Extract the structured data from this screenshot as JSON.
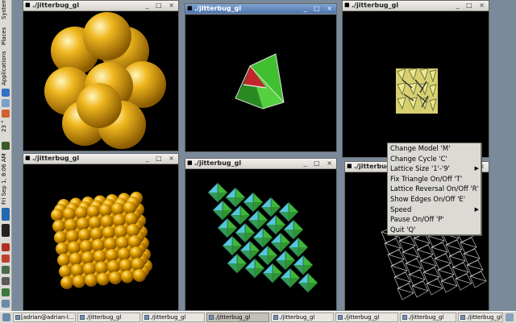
{
  "panel": {
    "menus": [
      "Applications",
      "Places",
      "System"
    ],
    "weather": "23 °",
    "clock": "Fri Sep 1, 8:06 AM",
    "colors": {
      "bg": "#dcdad5",
      "text": "#000000"
    }
  },
  "windows": [
    {
      "title": "./jitterbug_gl",
      "model": "spheres-large",
      "active": false
    },
    {
      "title": "./jitterbug_gl",
      "model": "octahedron",
      "active": true
    },
    {
      "title": "./jitterbug_gl",
      "model": "small-lattice",
      "active": false
    },
    {
      "title": "./jitterbug_gl",
      "model": "spheres-lattice",
      "active": false
    },
    {
      "title": "./jitterbug_gl",
      "model": "octahedra-lattice",
      "active": false
    },
    {
      "title": "./jitterbug_g",
      "model": "wireframe-lattice",
      "active": false
    }
  ],
  "window_buttons": "_ □ ×",
  "context_menu": {
    "items": [
      {
        "label": "Change Model  'M'",
        "submenu": false
      },
      {
        "label": "Change Cycle  'C'",
        "submenu": false
      },
      {
        "label": "Lattice Size  '1'-'9'",
        "submenu": true
      },
      {
        "label": "Fix Triangle On/Off  'T'",
        "submenu": false
      },
      {
        "label": "Lattice Reversal On/Off  'R'",
        "submenu": false
      },
      {
        "label": "Show Edges On/Off  'E'",
        "submenu": false
      },
      {
        "label": "Speed",
        "submenu": true
      },
      {
        "label": "Pause On/Off  'P'",
        "submenu": false
      },
      {
        "label": "Quit  'Q'",
        "submenu": false
      }
    ]
  },
  "taskbar": {
    "items": [
      {
        "label": "[adrian@adrian-l...",
        "pressed": false
      },
      {
        "label": "./jitterbug_gl",
        "pressed": false
      },
      {
        "label": "./jitterbug_gl",
        "pressed": false
      },
      {
        "label": "./jitterbug_gl",
        "pressed": true
      },
      {
        "label": "./jitterbug_gl",
        "pressed": false
      },
      {
        "label": "./jitterbug_gl",
        "pressed": false
      },
      {
        "label": "./jitterbug_gl",
        "pressed": false
      },
      {
        "label": "./jitterbug_gl",
        "pressed": false
      }
    ]
  },
  "colors": {
    "gold": "#e8a900",
    "green": "#3fb83a",
    "cyan": "#54c8d8",
    "red": "#c0262a",
    "wire": "#bbbbbb",
    "active_title": "#5a7fb6"
  }
}
